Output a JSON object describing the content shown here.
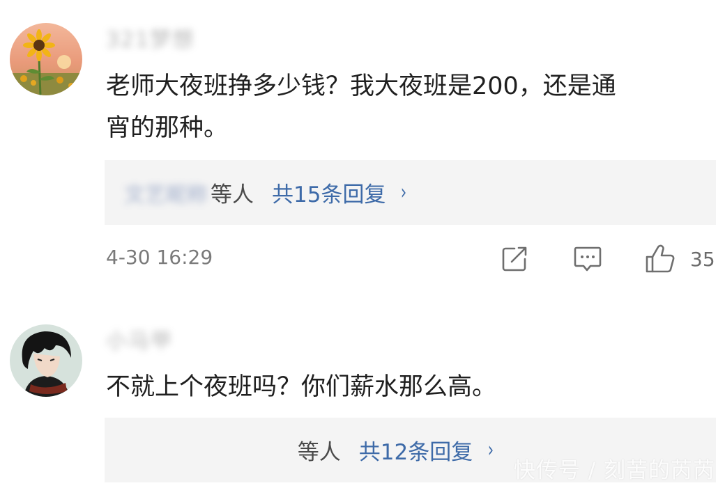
{
  "comments": [
    {
      "username": "321梦想",
      "text_line1": "老师大夜班挣多少钱？我大夜班是200，还是通",
      "text_line2": "宵的那种。",
      "replies": {
        "repliers": "文艺昵称",
        "others_label": "等人",
        "count_label": "共15条回复",
        "chevron": "›"
      },
      "timestamp": "4-30 16:29",
      "like_count": "35",
      "icons": [
        "share-icon",
        "comment-icon",
        "like-icon"
      ]
    },
    {
      "username": "小马甲",
      "text_line1": "不就上个夜班吗？你们薪水那么高。",
      "replies": {
        "others_label": "等人",
        "count_label": "共12条回复",
        "chevron": "›"
      }
    }
  ],
  "watermark": "快传号 / 刻苦的芮芮",
  "colors": {
    "link_blue": "#3d6aa8",
    "reply_bg": "#f4f4f4",
    "text_primary": "#1f1f1f",
    "text_secondary": "#7a7a7a"
  }
}
